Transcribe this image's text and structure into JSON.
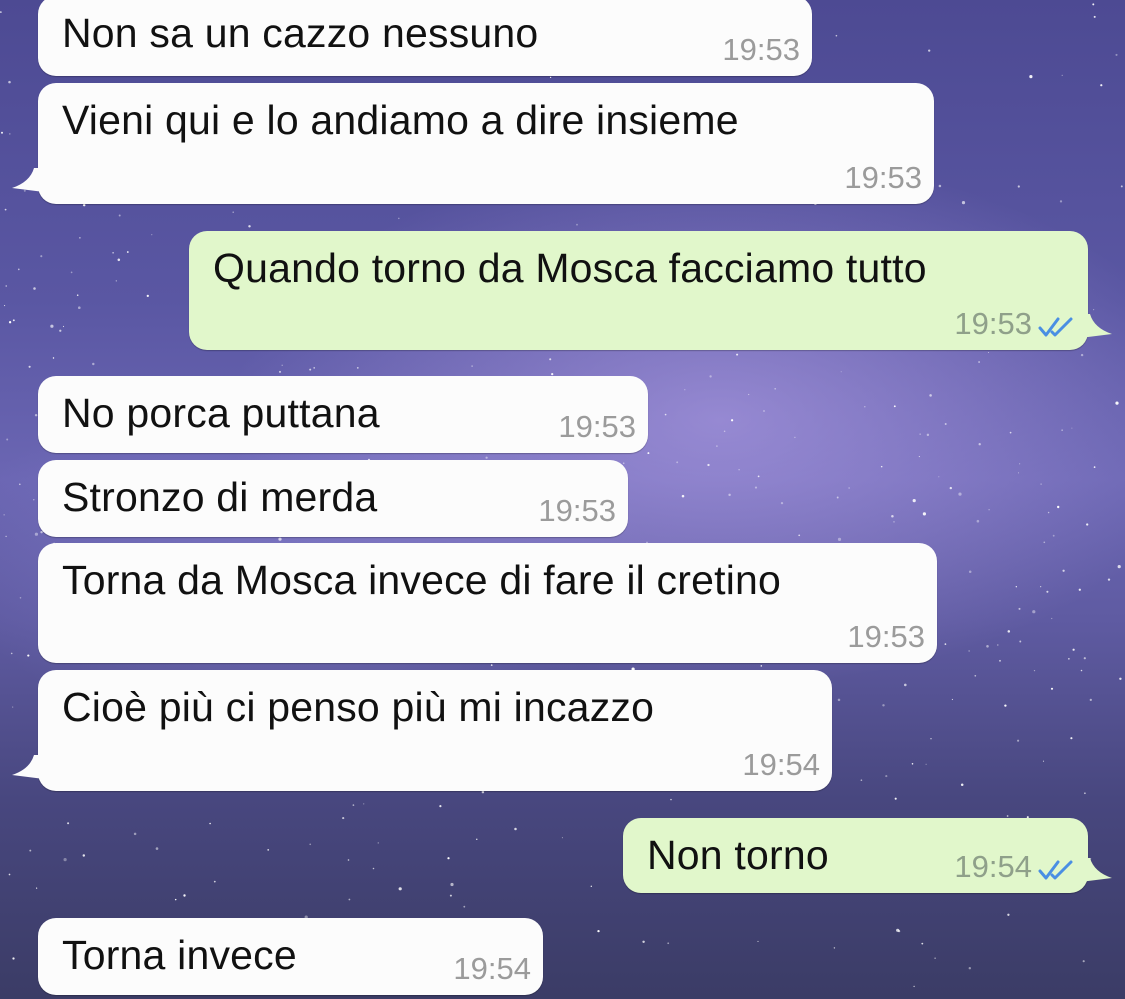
{
  "chat": {
    "messages": [
      {
        "direction": "incoming",
        "text": "Non sa un cazzo nessuno",
        "time": "19:53"
      },
      {
        "direction": "incoming",
        "text": "Vieni qui e lo andiamo a dire insieme",
        "time": "19:53"
      },
      {
        "direction": "outgoing",
        "text": "Quando torno da Mosca facciamo tutto",
        "time": "19:53",
        "status": "read-double-check-icon"
      },
      {
        "direction": "incoming",
        "text": "No porca puttana",
        "time": "19:53"
      },
      {
        "direction": "incoming",
        "text": "Stronzo di merda",
        "time": "19:53"
      },
      {
        "direction": "incoming",
        "text": "Torna da Mosca invece di fare il cretino",
        "time": "19:53"
      },
      {
        "direction": "incoming",
        "text": "Cioè più ci penso più mi incazzo",
        "time": "19:54"
      },
      {
        "direction": "outgoing",
        "text": "Non torno",
        "time": "19:54",
        "status": "read-double-check-icon"
      },
      {
        "direction": "incoming",
        "text": "Torna invece",
        "time": "19:54"
      }
    ]
  },
  "colors": {
    "incoming_bubble": "#fcfcfc",
    "outgoing_bubble": "#e1f7cb",
    "read_tick": "#4a8fe3",
    "timestamp": "#9b9b9b"
  }
}
